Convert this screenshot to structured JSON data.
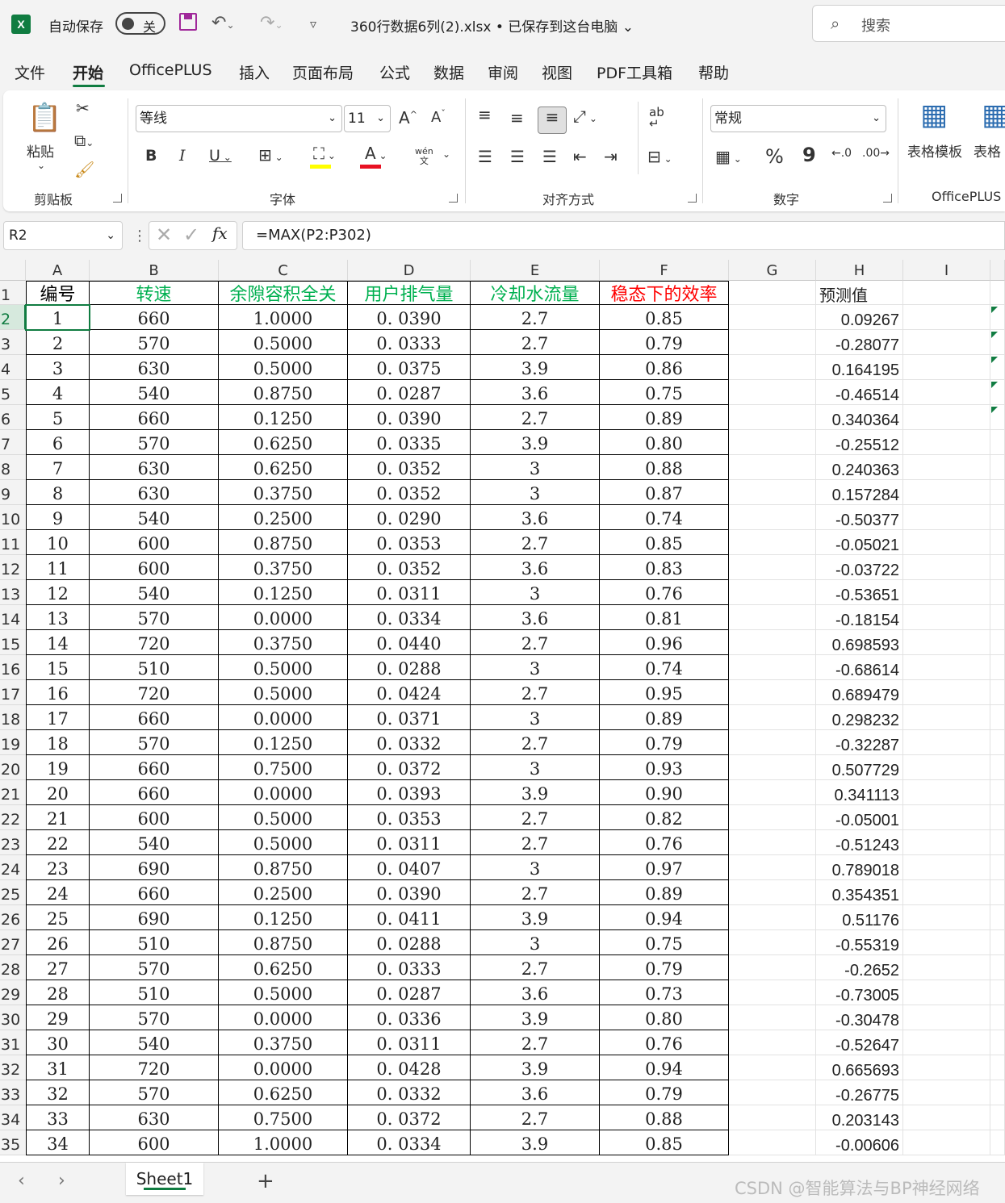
{
  "titlebar": {
    "app_logo": "X",
    "autosave_label": "自动保存",
    "autosave_state": "关",
    "file_title": "360行数据6列(2).xlsx • 已保存到这台电脑",
    "search_placeholder": "搜索"
  },
  "menu": [
    "文件",
    "开始",
    "OfficePLUS",
    "插入",
    "页面布局",
    "公式",
    "数据",
    "审阅",
    "视图",
    "PDF工具箱",
    "帮助"
  ],
  "ribbon": {
    "clipboard": {
      "paste": "粘贴",
      "label": "剪贴板"
    },
    "font": {
      "name": "等线",
      "size": "11",
      "label": "字体",
      "grow": "A",
      "shrink": "A",
      "bold": "B",
      "italic": "I",
      "underline": "U",
      "font_color": "A",
      "wen": "wén",
      "wen2": "文"
    },
    "align": {
      "label": "对齐方式",
      "ab": "ab"
    },
    "number": {
      "format": "常规",
      "label": "数字",
      "percent": "%",
      "comma": "9"
    },
    "officeplus": {
      "table_template": "表格模板",
      "table2": "表格",
      "label": "OfficePLUS"
    },
    "accent": "#107c41",
    "fill_color": "#ffff00",
    "font_color_bar": "#e81123"
  },
  "formula_bar": {
    "name_box": "R2",
    "fx": "fx",
    "formula": "=MAX(P2:P302)"
  },
  "columns": [
    "A",
    "B",
    "C",
    "D",
    "E",
    "F",
    "G",
    "H",
    "I"
  ],
  "header_row": {
    "number": "1",
    "cells": [
      "编号",
      "转速",
      "余隙容积全关",
      "用户排气量",
      "冷却水流量",
      "稳态下的效率"
    ],
    "colors": [
      "#000000",
      "#00b050",
      "#00b050",
      "#00b050",
      "#00b050",
      "#ff0000"
    ],
    "h": "预测值"
  },
  "rows": [
    {
      "r": "2",
      "a": "1",
      "b": "660",
      "c": "1.0000",
      "d": "0. 0390",
      "e": "2.7",
      "f": "0.85",
      "h": "0.09267"
    },
    {
      "r": "3",
      "a": "2",
      "b": "570",
      "c": "0.5000",
      "d": "0. 0333",
      "e": "2.7",
      "f": "0.79",
      "h": "-0.28077"
    },
    {
      "r": "4",
      "a": "3",
      "b": "630",
      "c": "0.5000",
      "d": "0. 0375",
      "e": "3.9",
      "f": "0.86",
      "h": "0.164195"
    },
    {
      "r": "5",
      "a": "4",
      "b": "540",
      "c": "0.8750",
      "d": "0. 0287",
      "e": "3.6",
      "f": "0.75",
      "h": "-0.46514"
    },
    {
      "r": "6",
      "a": "5",
      "b": "660",
      "c": "0.1250",
      "d": "0. 0390",
      "e": "2.7",
      "f": "0.89",
      "h": "0.340364"
    },
    {
      "r": "7",
      "a": "6",
      "b": "570",
      "c": "0.6250",
      "d": "0. 0335",
      "e": "3.9",
      "f": "0.80",
      "h": "-0.25512"
    },
    {
      "r": "8",
      "a": "7",
      "b": "630",
      "c": "0.6250",
      "d": "0. 0352",
      "e": "3",
      "f": "0.88",
      "h": "0.240363"
    },
    {
      "r": "9",
      "a": "8",
      "b": "630",
      "c": "0.3750",
      "d": "0. 0352",
      "e": "3",
      "f": "0.87",
      "h": "0.157284"
    },
    {
      "r": "10",
      "a": "9",
      "b": "540",
      "c": "0.2500",
      "d": "0. 0290",
      "e": "3.6",
      "f": "0.74",
      "h": "-0.50377"
    },
    {
      "r": "11",
      "a": "10",
      "b": "600",
      "c": "0.8750",
      "d": "0. 0353",
      "e": "2.7",
      "f": "0.85",
      "h": "-0.05021"
    },
    {
      "r": "12",
      "a": "11",
      "b": "600",
      "c": "0.3750",
      "d": "0. 0352",
      "e": "3.6",
      "f": "0.83",
      "h": "-0.03722"
    },
    {
      "r": "13",
      "a": "12",
      "b": "540",
      "c": "0.1250",
      "d": "0. 0311",
      "e": "3",
      "f": "0.76",
      "h": "-0.53651"
    },
    {
      "r": "14",
      "a": "13",
      "b": "570",
      "c": "0.0000",
      "d": "0. 0334",
      "e": "3.6",
      "f": "0.81",
      "h": "-0.18154"
    },
    {
      "r": "15",
      "a": "14",
      "b": "720",
      "c": "0.3750",
      "d": "0. 0440",
      "e": "2.7",
      "f": "0.96",
      "h": "0.698593"
    },
    {
      "r": "16",
      "a": "15",
      "b": "510",
      "c": "0.5000",
      "d": "0. 0288",
      "e": "3",
      "f": "0.74",
      "h": "-0.68614"
    },
    {
      "r": "17",
      "a": "16",
      "b": "720",
      "c": "0.5000",
      "d": "0. 0424",
      "e": "2.7",
      "f": "0.95",
      "h": "0.689479"
    },
    {
      "r": "18",
      "a": "17",
      "b": "660",
      "c": "0.0000",
      "d": "0. 0371",
      "e": "3",
      "f": "0.89",
      "h": "0.298232"
    },
    {
      "r": "19",
      "a": "18",
      "b": "570",
      "c": "0.1250",
      "d": "0. 0332",
      "e": "2.7",
      "f": "0.79",
      "h": "-0.32287"
    },
    {
      "r": "20",
      "a": "19",
      "b": "660",
      "c": "0.7500",
      "d": "0. 0372",
      "e": "3",
      "f": "0.93",
      "h": "0.507729"
    },
    {
      "r": "21",
      "a": "20",
      "b": "660",
      "c": "0.0000",
      "d": "0. 0393",
      "e": "3.9",
      "f": "0.90",
      "h": "0.341113"
    },
    {
      "r": "22",
      "a": "21",
      "b": "600",
      "c": "0.5000",
      "d": "0. 0353",
      "e": "2.7",
      "f": "0.82",
      "h": "-0.05001"
    },
    {
      "r": "23",
      "a": "22",
      "b": "540",
      "c": "0.5000",
      "d": "0. 0311",
      "e": "2.7",
      "f": "0.76",
      "h": "-0.51243"
    },
    {
      "r": "24",
      "a": "23",
      "b": "690",
      "c": "0.8750",
      "d": "0. 0407",
      "e": "3",
      "f": "0.97",
      "h": "0.789018"
    },
    {
      "r": "25",
      "a": "24",
      "b": "660",
      "c": "0.2500",
      "d": "0. 0390",
      "e": "2.7",
      "f": "0.89",
      "h": "0.354351"
    },
    {
      "r": "26",
      "a": "25",
      "b": "690",
      "c": "0.1250",
      "d": "0. 0411",
      "e": "3.9",
      "f": "0.94",
      "h": "0.51176"
    },
    {
      "r": "27",
      "a": "26",
      "b": "510",
      "c": "0.8750",
      "d": "0. 0288",
      "e": "3",
      "f": "0.75",
      "h": "-0.55319"
    },
    {
      "r": "28",
      "a": "27",
      "b": "570",
      "c": "0.6250",
      "d": "0. 0333",
      "e": "2.7",
      "f": "0.79",
      "h": "-0.2652"
    },
    {
      "r": "29",
      "a": "28",
      "b": "510",
      "c": "0.5000",
      "d": "0. 0287",
      "e": "3.6",
      "f": "0.73",
      "h": "-0.73005"
    },
    {
      "r": "30",
      "a": "29",
      "b": "570",
      "c": "0.0000",
      "d": "0. 0336",
      "e": "3.9",
      "f": "0.80",
      "h": "-0.30478"
    },
    {
      "r": "31",
      "a": "30",
      "b": "540",
      "c": "0.3750",
      "d": "0. 0311",
      "e": "2.7",
      "f": "0.76",
      "h": "-0.52647"
    },
    {
      "r": "32",
      "a": "31",
      "b": "720",
      "c": "0.0000",
      "d": "0. 0428",
      "e": "3.9",
      "f": "0.94",
      "h": "0.665693"
    },
    {
      "r": "33",
      "a": "32",
      "b": "570",
      "c": "0.6250",
      "d": "0. 0332",
      "e": "3.6",
      "f": "0.79",
      "h": "-0.26775"
    },
    {
      "r": "34",
      "a": "33",
      "b": "630",
      "c": "0.7500",
      "d": "0. 0372",
      "e": "2.7",
      "f": "0.88",
      "h": "0.203143"
    },
    {
      "r": "35",
      "a": "34",
      "b": "600",
      "c": "1.0000",
      "d": "0. 0334",
      "e": "3.9",
      "f": "0.85",
      "h": "-0.00606"
    }
  ],
  "tabs": {
    "sheet": "Sheet1",
    "prev": "‹",
    "next": "›",
    "add": "+"
  },
  "watermark": "CSDN @智能算法与BP神经网络"
}
